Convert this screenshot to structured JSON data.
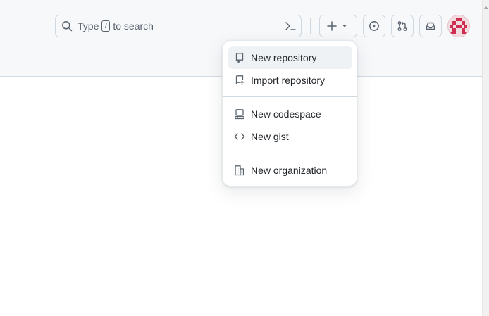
{
  "header": {
    "search": {
      "hint_before": "Type",
      "hint_key": "/",
      "hint_after": "to search"
    }
  },
  "icons": {
    "search": "search-icon",
    "command_palette": "terminal-icon",
    "create": "plus-icon",
    "create_caret": "triangle-down-icon",
    "issues": "issue-opened-icon",
    "pull_requests": "git-pull-request-icon",
    "inbox": "inbox-icon",
    "avatar": "identicon-avatar"
  },
  "colors": {
    "avatar": "#cf2e52",
    "active_item": "#eff2f5"
  },
  "create_menu": {
    "items": [
      {
        "label": "New repository",
        "icon": "repo-icon",
        "active": true
      },
      {
        "label": "Import repository",
        "icon": "repo-push-icon",
        "active": false
      },
      {
        "label": "New codespace",
        "icon": "codespaces-icon",
        "active": false
      },
      {
        "label": "New gist",
        "icon": "code-icon",
        "active": false
      },
      {
        "label": "New organization",
        "icon": "organization-icon",
        "active": false
      }
    ]
  }
}
